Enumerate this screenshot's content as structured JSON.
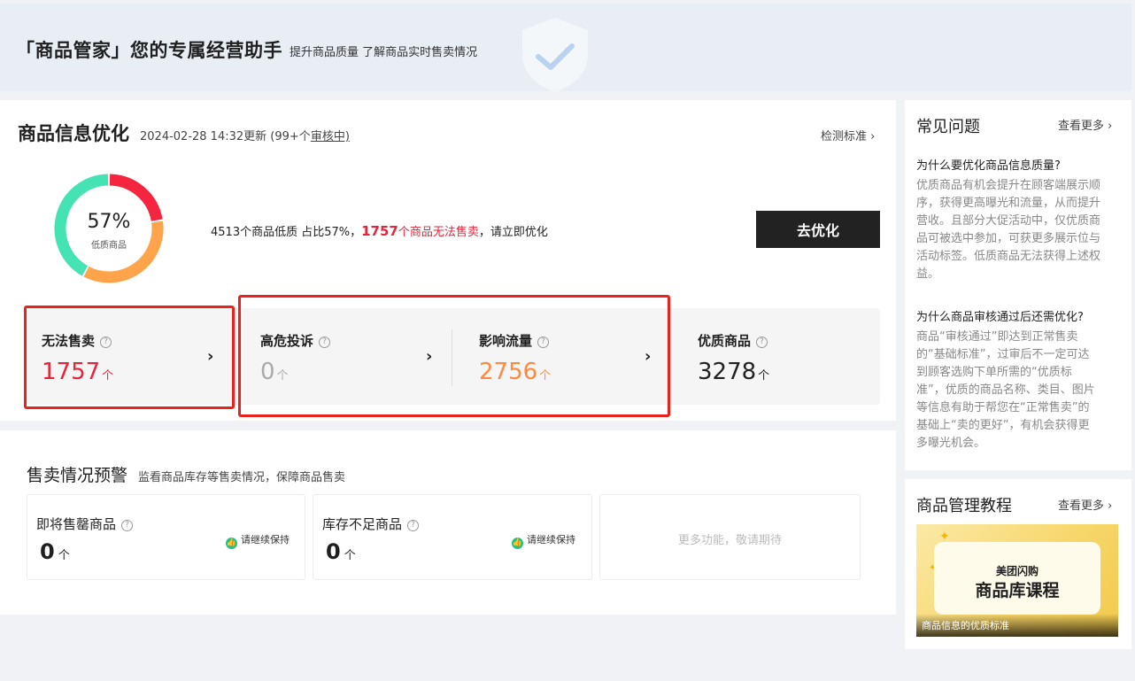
{
  "banner": {
    "title": "「商品管家」您的专属经营助手",
    "subtitle": "提升商品质量 了解商品实时售卖情况"
  },
  "optimize": {
    "title": "商品信息优化",
    "updated": "2024-02-28 14:32更新",
    "review_prefix": "(99+个",
    "review_link": "审核中)",
    "criteria_link": "检测标准 ›",
    "donut": {
      "percent_label": "57%",
      "label": "低质商品",
      "segments": [
        {
          "name": "无法售卖",
          "value": 1757,
          "color": "#f5253f"
        },
        {
          "name": "影响流量",
          "value": 2756,
          "color": "#ffa44a"
        },
        {
          "name": "优质商品",
          "value": 3278,
          "color": "#45e2b3"
        }
      ]
    },
    "summary_prefix": "4513个商品低质 占比57%，",
    "summary_count": "1757",
    "summary_red": "个商品无法售卖",
    "summary_suffix": "，请立即优化",
    "button": "去优化",
    "stats": [
      {
        "title": "无法售卖",
        "value": "1757",
        "unit": "个",
        "color": "#e6243a"
      },
      {
        "title": "高危投诉",
        "value": "0",
        "unit": "个",
        "color": "#aaaaaa"
      },
      {
        "title": "影响流量",
        "value": "2756",
        "unit": "个",
        "color": "#ff8a3d"
      },
      {
        "title": "优质商品",
        "value": "3278",
        "unit": "个",
        "color": "#222222"
      }
    ]
  },
  "warning": {
    "title": "售卖情况预警",
    "subtitle": "监看商品库存等售卖情况，保障商品售卖",
    "boxes": [
      {
        "title": "即将售罄商品",
        "value": "0",
        "unit": "个",
        "status": "请继续保持"
      },
      {
        "title": "库存不足商品",
        "value": "0",
        "unit": "个",
        "status": "请继续保持"
      }
    ],
    "more": "更多功能，敬请期待"
  },
  "faq": {
    "title": "常见问题",
    "more": "查看更多 ›",
    "items": [
      {
        "q": "为什么要优化商品信息质量?",
        "a": [
          "优质商品有机会提升在顾客端展示顺",
          "序，获得更高曝光和流量，从而提升",
          "营收。且部分大促活动中，仅优质商",
          "品可被选中参加，可获更多展示位与",
          "活动标签。低质商品无法获得上述权",
          "益。"
        ]
      },
      {
        "q": "为什么商品审核通过后还需优化?",
        "a": [
          "商品“审核通过”即达到正常售卖",
          "的“基础标准”，过审后不一定可达",
          "到顾客选购下单所需的“优质标",
          "准”，优质的商品名称、类目、图片",
          "等信息有助于帮您在“正常售卖”的",
          "基础上“卖的更好”，有机会获得更",
          "多曝光机会。"
        ]
      }
    ]
  },
  "tutorial": {
    "title": "商品管理教程",
    "more": "查看更多 ›",
    "brand": "美团闪购",
    "course": "商品库课程",
    "caption": "商品信息的优质标准"
  }
}
